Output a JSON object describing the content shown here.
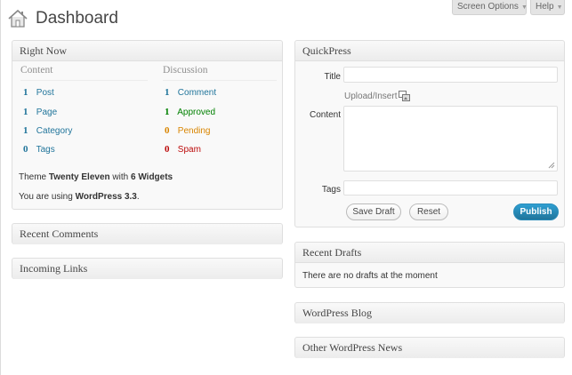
{
  "header": {
    "title": "Dashboard",
    "screen_options": "Screen Options",
    "help": "Help"
  },
  "right_now": {
    "title": "Right Now",
    "content_heading": "Content",
    "discussion_heading": "Discussion",
    "content": [
      {
        "count": "1",
        "label": "Post"
      },
      {
        "count": "1",
        "label": "Page"
      },
      {
        "count": "1",
        "label": "Category"
      },
      {
        "count": "0",
        "label": "Tags"
      }
    ],
    "discussion": [
      {
        "count": "1",
        "label": "Comment"
      },
      {
        "count": "1",
        "label": "Approved"
      },
      {
        "count": "0",
        "label": "Pending"
      },
      {
        "count": "0",
        "label": "Spam"
      }
    ],
    "theme_prefix": "Theme ",
    "theme_name": "Twenty Eleven",
    "theme_with": " with ",
    "widgets": "6 Widgets",
    "version_prefix": "You are using ",
    "version": "WordPress 3.3",
    "version_suffix": "."
  },
  "recent_comments": {
    "title": "Recent Comments"
  },
  "incoming_links": {
    "title": "Incoming Links"
  },
  "quickpress": {
    "title": "QuickPress",
    "title_label": "Title",
    "title_value": "",
    "upload_label": "Upload/Insert",
    "content_label": "Content",
    "content_value": "",
    "tags_label": "Tags",
    "tags_value": "",
    "save_draft": "Save Draft",
    "reset": "Reset",
    "publish": "Publish"
  },
  "recent_drafts": {
    "title": "Recent Drafts",
    "message": "There are no drafts at the moment"
  },
  "wordpress_blog": {
    "title": "WordPress Blog"
  },
  "other_news": {
    "title": "Other WordPress News"
  },
  "colors": {
    "link": "#21759b",
    "approved": "#008000",
    "pending": "#d98500",
    "spam": "#bc0b0b",
    "publish_button": "#21759b"
  }
}
